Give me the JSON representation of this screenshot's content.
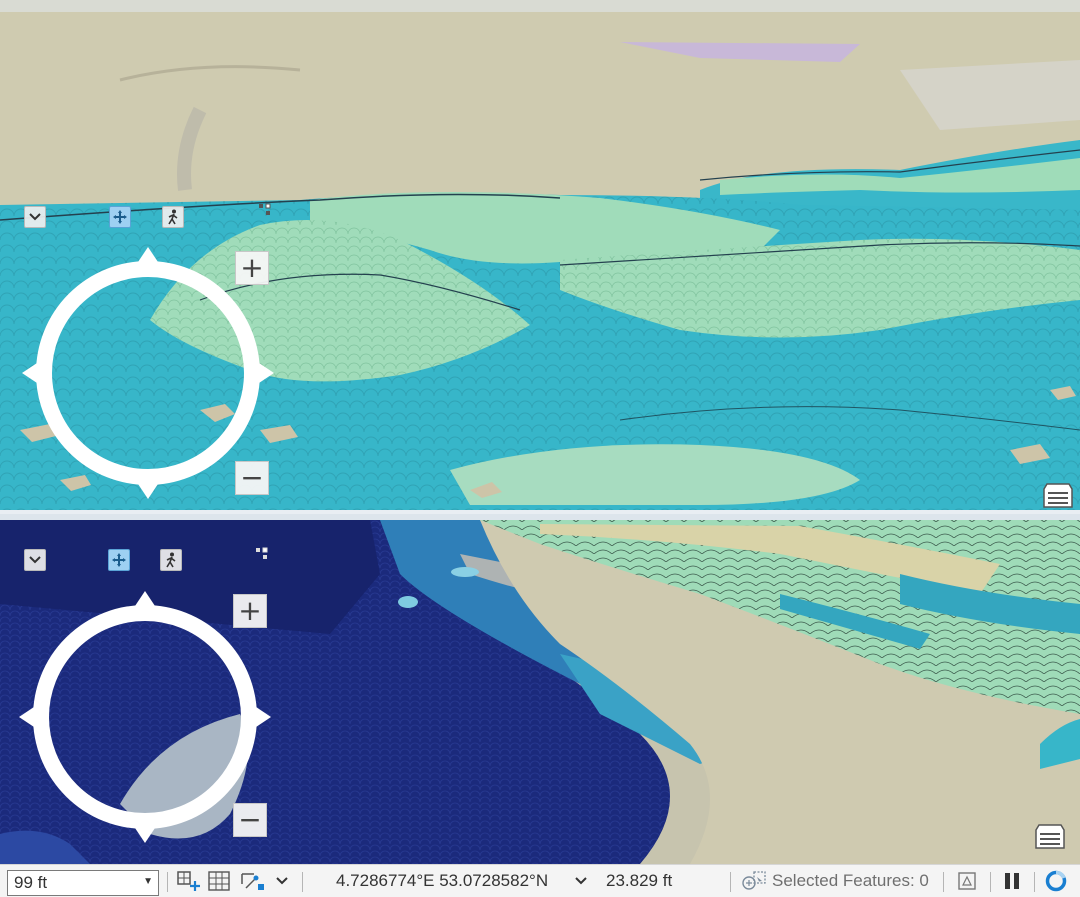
{
  "views": [
    {
      "id": "top",
      "navigator": {
        "expand_icon": "chevron-down-icon",
        "pan_icon": "pan-arrows-icon",
        "walk_icon": "walk-person-icon",
        "full_control_icon": "small-squares-icon",
        "zoom_in": "+",
        "zoom_out": "−"
      },
      "legend_icon": "legend-panel-icon"
    },
    {
      "id": "bottom",
      "navigator": {
        "expand_icon": "chevron-down-icon",
        "pan_icon": "pan-arrows-icon",
        "walk_icon": "walk-person-icon",
        "full_control_icon": "small-squares-icon",
        "zoom_in": "+",
        "zoom_out": "−"
      },
      "legend_icon": "legend-panel-icon"
    }
  ],
  "statusbar": {
    "scale": "99 ft",
    "coordinates": "4.7286774°E 53.0728582°N",
    "elevation": "23.829 ft",
    "selected_features": "Selected Features: 0",
    "icons": [
      "add-layer-icon",
      "grid-icon",
      "snapping-icon",
      "chevron-down-icon",
      "selection-icon",
      "scene-icon",
      "pause-icon",
      "refresh-icon"
    ]
  },
  "colors": {
    "land": "#cdc9ac",
    "vegetation_light": "#9fdcb9",
    "water_shallow": "#37b6c9",
    "water_deep": "#1b2a7c",
    "accent": "#1a7fd1"
  }
}
